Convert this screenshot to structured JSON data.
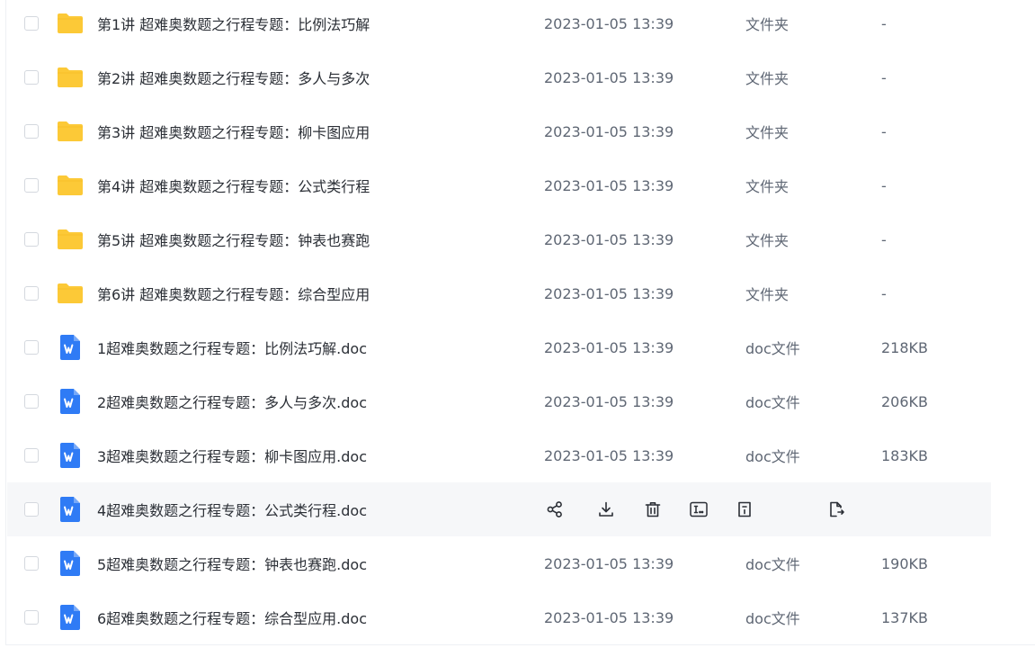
{
  "files": [
    {
      "name": "第1讲 超难奥数题之行程专题：比例法巧解",
      "date": "2023-01-05 13:39",
      "type": "文件夹",
      "size": "-",
      "icon": "folder-icon"
    },
    {
      "name": "第2讲 超难奥数题之行程专题：多人与多次",
      "date": "2023-01-05 13:39",
      "type": "文件夹",
      "size": "-",
      "icon": "folder-icon"
    },
    {
      "name": "第3讲 超难奥数题之行程专题：柳卡图应用",
      "date": "2023-01-05 13:39",
      "type": "文件夹",
      "size": "-",
      "icon": "folder-icon"
    },
    {
      "name": "第4讲 超难奥数题之行程专题：公式类行程",
      "date": "2023-01-05 13:39",
      "type": "文件夹",
      "size": "-",
      "icon": "folder-icon"
    },
    {
      "name": "第5讲 超难奥数题之行程专题：钟表也赛跑",
      "date": "2023-01-05 13:39",
      "type": "文件夹",
      "size": "-",
      "icon": "folder-icon"
    },
    {
      "name": "第6讲 超难奥数题之行程专题：综合型应用",
      "date": "2023-01-05 13:39",
      "type": "文件夹",
      "size": "-",
      "icon": "folder-icon"
    },
    {
      "name": "1超难奥数题之行程专题：比例法巧解.doc",
      "date": "2023-01-05 13:39",
      "type": "doc文件",
      "size": "218KB",
      "icon": "word-doc-icon"
    },
    {
      "name": "2超难奥数题之行程专题：多人与多次.doc",
      "date": "2023-01-05 13:39",
      "type": "doc文件",
      "size": "206KB",
      "icon": "word-doc-icon"
    },
    {
      "name": "3超难奥数题之行程专题：柳卡图应用.doc",
      "date": "2023-01-05 13:39",
      "type": "doc文件",
      "size": "183KB",
      "icon": "word-doc-icon"
    },
    {
      "name": "4超难奥数题之行程专题：公式类行程.doc",
      "date": "",
      "type": "",
      "size": "",
      "icon": "word-doc-icon",
      "hovered": true
    },
    {
      "name": "5超难奥数题之行程专题：钟表也赛跑.doc",
      "date": "2023-01-05 13:39",
      "type": "doc文件",
      "size": "190KB",
      "icon": "word-doc-icon"
    },
    {
      "name": "6超难奥数题之行程专题：综合型应用.doc",
      "date": "2023-01-05 13:39",
      "type": "doc文件",
      "size": "137KB",
      "icon": "word-doc-icon"
    }
  ],
  "row_actions": [
    "share-icon",
    "download-icon",
    "delete-icon",
    "rename-icon",
    "move-icon",
    "copy-icon"
  ],
  "colors": {
    "folder": "#fcc937",
    "word_doc": "#2f7bf5",
    "hover_row": "#f6f7f9",
    "action_icon": "#2b2f36"
  }
}
